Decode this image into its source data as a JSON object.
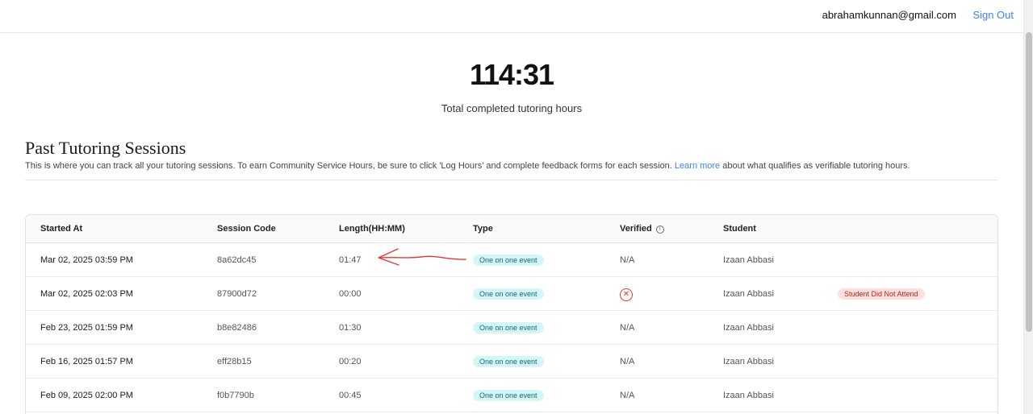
{
  "header": {
    "email": "abrahamkunnan@gmail.com",
    "sign_out": "Sign Out"
  },
  "summary": {
    "value": "114:31",
    "label": "Total completed tutoring hours"
  },
  "section": {
    "title": "Past Tutoring Sessions",
    "desc_before": "This is where you can track all your tutoring sessions. To earn Community Service Hours, be sure to click 'Log Hours' and complete feedback forms for each session. ",
    "desc_link": "Learn more",
    "desc_after": " about what qualifies as verifiable tutoring hours."
  },
  "table": {
    "columns": [
      "Started At",
      "Session Code",
      "Length(HH:MM)",
      "Type",
      "Verified",
      "Student"
    ],
    "rows": [
      {
        "started": "Mar 02, 2025 03:59 PM",
        "code": "8a62dc45",
        "length": "01:47",
        "type": "One on one event",
        "verified": "N/A",
        "student": "Izaan Abbasi",
        "status": ""
      },
      {
        "started": "Mar 02, 2025 02:03 PM",
        "code": "87900d72",
        "length": "00:00",
        "type": "One on one event",
        "verified": "",
        "student": "Izaan Abbasi",
        "status": "Student Did Not Attend"
      },
      {
        "started": "Feb 23, 2025 01:59 PM",
        "code": "b8e82486",
        "length": "01:30",
        "type": "One on one event",
        "verified": "N/A",
        "student": "Izaan Abbasi",
        "status": ""
      },
      {
        "started": "Feb 16, 2025 01:57 PM",
        "code": "eff28b15",
        "length": "00:20",
        "type": "One on one event",
        "verified": "N/A",
        "student": "Izaan Abbasi",
        "status": ""
      },
      {
        "started": "Feb 09, 2025 02:00 PM",
        "code": "f0b7790b",
        "length": "00:45",
        "type": "One on one event",
        "verified": "N/A",
        "student": "Izaan Abbasi",
        "status": ""
      }
    ]
  },
  "icons": {
    "info": "info-icon",
    "not_verified": "x-circle-icon",
    "annotation": "red-arrow-annotation"
  },
  "colors": {
    "link": "#3b82f6",
    "type_badge": "#d5f6f7",
    "status_badge": "#fbe0df",
    "error": "#e53935"
  }
}
